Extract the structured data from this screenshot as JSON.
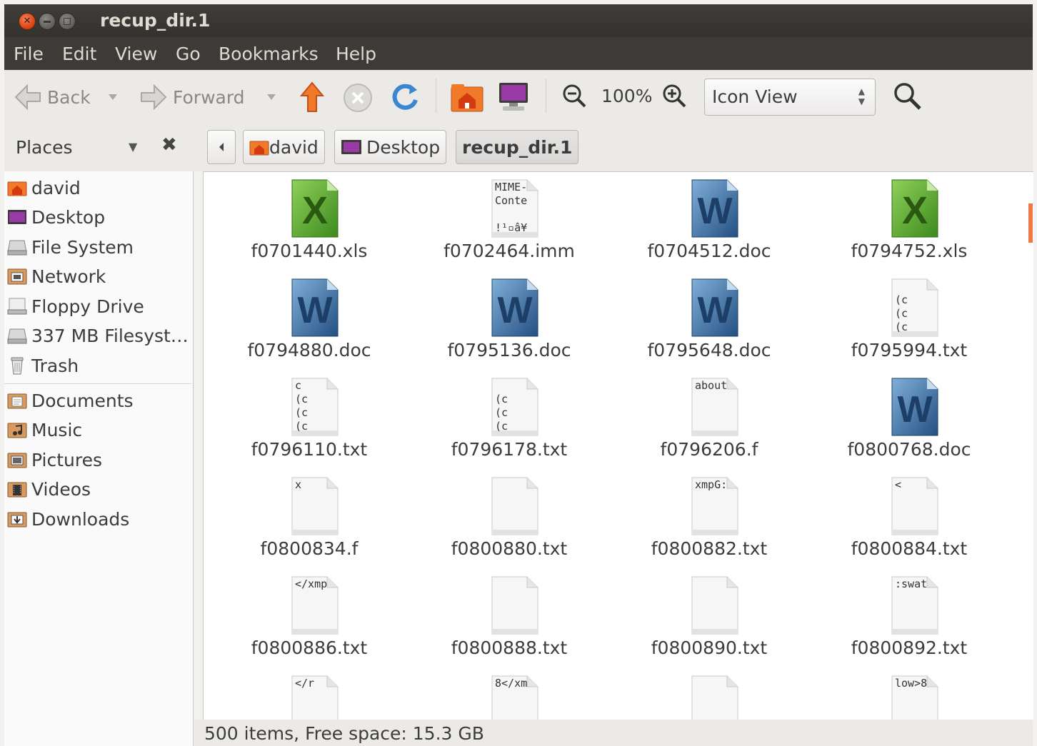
{
  "window": {
    "title": "recup_dir.1"
  },
  "menu": [
    "File",
    "Edit",
    "View",
    "Go",
    "Bookmarks",
    "Help"
  ],
  "toolbar": {
    "back": "Back",
    "forward": "Forward",
    "zoom": "100%",
    "view_mode": "Icon View"
  },
  "places": {
    "label": "Places",
    "items": [
      {
        "label": "david",
        "icon": "home-folder-icon"
      },
      {
        "label": "Desktop",
        "icon": "desktop-folder-icon"
      },
      {
        "label": "File System",
        "icon": "harddrive-icon"
      },
      {
        "label": "Network",
        "icon": "network-icon"
      },
      {
        "label": "Floppy Drive",
        "icon": "floppy-icon"
      },
      {
        "label": "337 MB Filesyst…",
        "icon": "harddrive-icon"
      },
      {
        "label": "Trash",
        "icon": "trash-icon"
      }
    ],
    "bookmarks": [
      {
        "label": "Documents",
        "icon": "documents-folder-icon"
      },
      {
        "label": "Music",
        "icon": "music-folder-icon"
      },
      {
        "label": "Pictures",
        "icon": "pictures-folder-icon"
      },
      {
        "label": "Videos",
        "icon": "videos-folder-icon"
      },
      {
        "label": "Downloads",
        "icon": "downloads-folder-icon"
      }
    ]
  },
  "path": [
    "david",
    "Desktop",
    "recup_dir.1"
  ],
  "files": [
    {
      "name": "f0701440.xls",
      "type": "xls",
      "preview": []
    },
    {
      "name": "f0702464.imm",
      "type": "text",
      "preview": [
        "MIME-",
        "Conte",
        "",
        "!¹▫â¥"
      ]
    },
    {
      "name": "f0704512.doc",
      "type": "doc",
      "preview": []
    },
    {
      "name": "f0794752.xls",
      "type": "xls",
      "preview": []
    },
    {
      "name": "f0794880.doc",
      "type": "doc",
      "preview": []
    },
    {
      "name": "f0795136.doc",
      "type": "doc",
      "preview": []
    },
    {
      "name": "f0795648.doc",
      "type": "doc",
      "preview": []
    },
    {
      "name": "f0795994.txt",
      "type": "text",
      "preview": [
        "",
        "(c",
        "(c",
        "(c"
      ]
    },
    {
      "name": "f0796110.txt",
      "type": "text",
      "preview": [
        "c",
        "(c",
        "(c",
        "(c"
      ]
    },
    {
      "name": "f0796178.txt",
      "type": "text",
      "preview": [
        "",
        "(c",
        "(c",
        "(c"
      ]
    },
    {
      "name": "f0796206.f",
      "type": "text",
      "preview": [
        "about"
      ]
    },
    {
      "name": "f0800768.doc",
      "type": "doc",
      "preview": []
    },
    {
      "name": "f0800834.f",
      "type": "text",
      "preview": [
        "x"
      ]
    },
    {
      "name": "f0800880.txt",
      "type": "text",
      "preview": []
    },
    {
      "name": "f0800882.txt",
      "type": "text",
      "preview": [
        "xmpG:"
      ]
    },
    {
      "name": "f0800884.txt",
      "type": "text",
      "preview": [
        "<"
      ]
    },
    {
      "name": "f0800886.txt",
      "type": "text",
      "preview": [
        "</xmp"
      ]
    },
    {
      "name": "f0800888.txt",
      "type": "text",
      "preview": []
    },
    {
      "name": "f0800890.txt",
      "type": "text",
      "preview": []
    },
    {
      "name": "f0800892.txt",
      "type": "text",
      "preview": [
        ":swat"
      ]
    },
    {
      "name": "",
      "type": "text",
      "preview": [
        "</r"
      ]
    },
    {
      "name": "",
      "type": "text",
      "preview": [
        "8</xm"
      ]
    },
    {
      "name": "",
      "type": "text",
      "preview": []
    },
    {
      "name": "",
      "type": "text",
      "preview": [
        "low>8"
      ]
    }
  ],
  "status": "500 items, Free space: 15.3 GB",
  "colors": {
    "accent": "#dd4814",
    "menubar": "#3c3b37",
    "xls_green": "#4c9a2a",
    "doc_blue": "#2f5f95"
  }
}
